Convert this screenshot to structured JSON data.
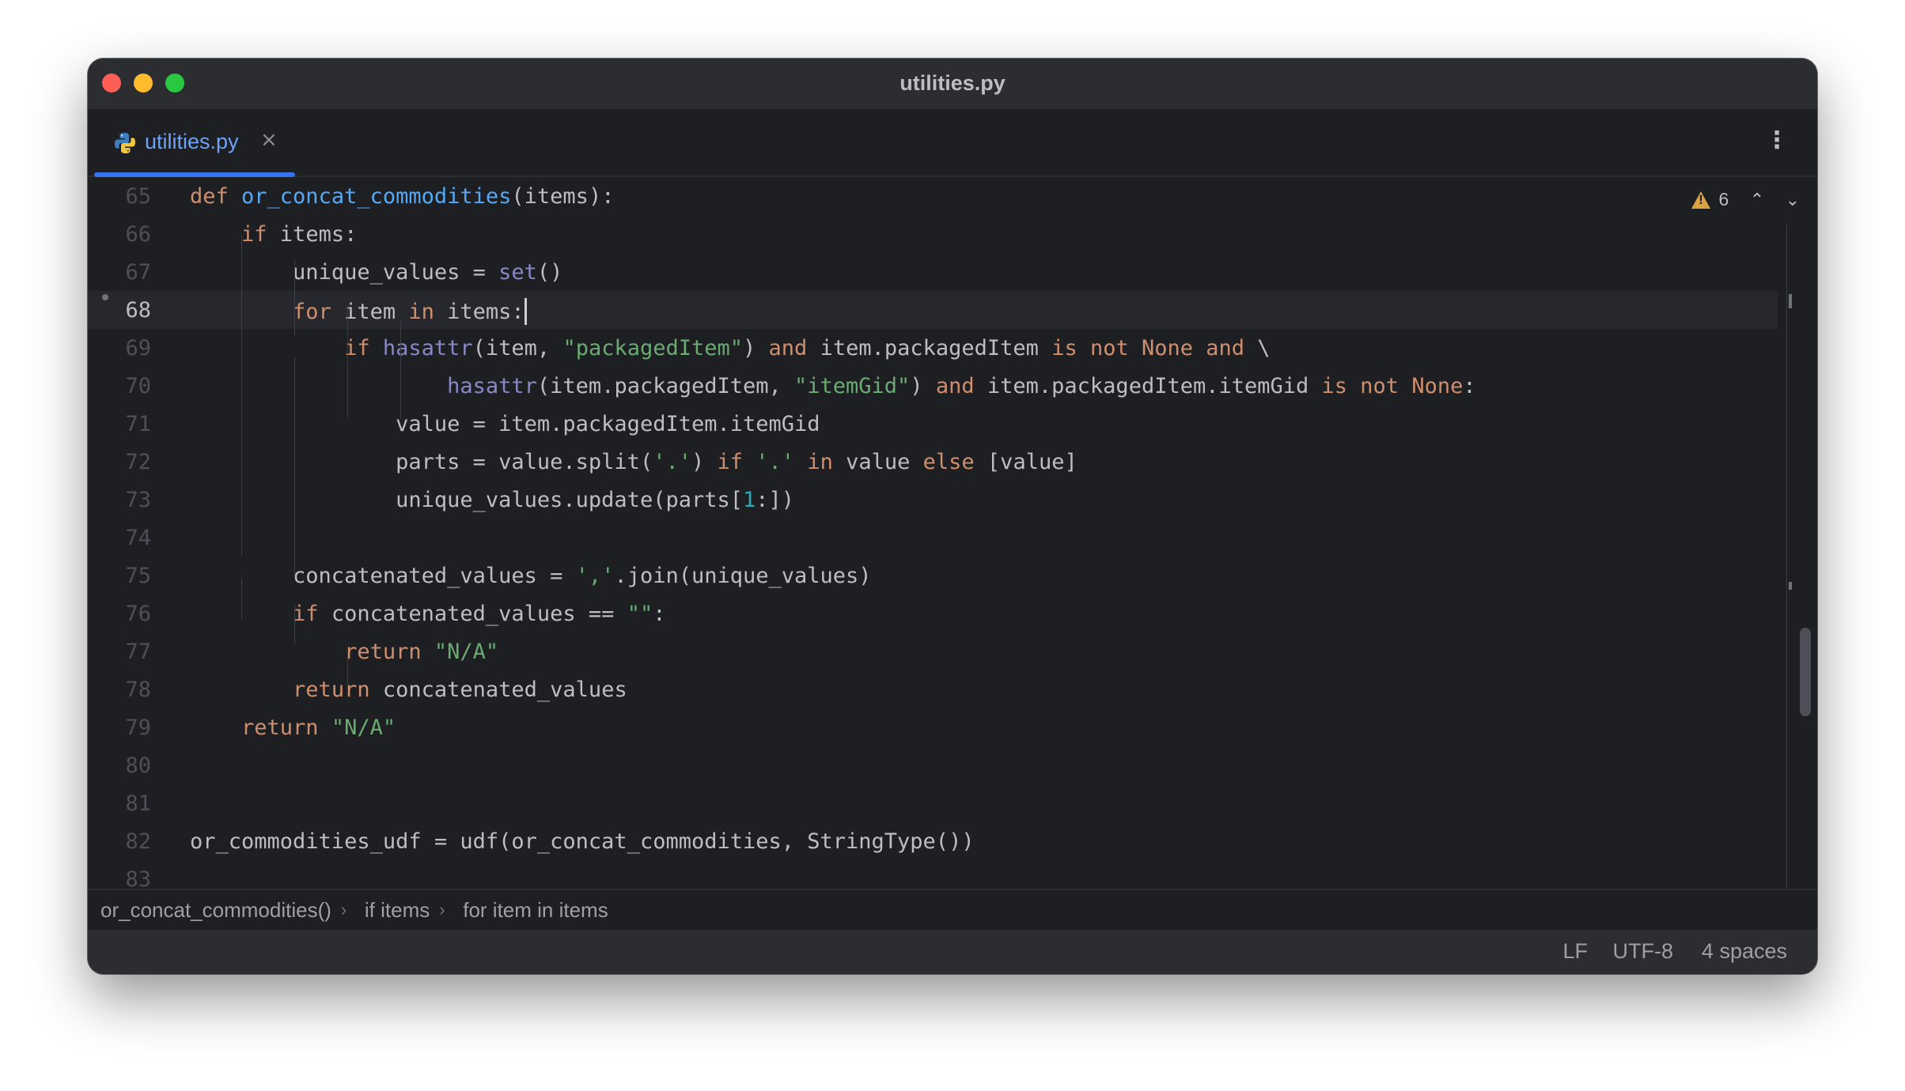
{
  "window": {
    "title": "utilities.py"
  },
  "tab": {
    "label": "utilities.py",
    "close_glyph": "×",
    "menu_glyph": "⋮"
  },
  "inspections": {
    "warning_count": "6",
    "prev_glyph": "⌃",
    "next_glyph": "⌄"
  },
  "editor": {
    "current_line": 68,
    "lines": [
      {
        "num": "65",
        "segments": [
          {
            "t": "def ",
            "c": "kw"
          },
          {
            "t": "or_concat_commodities",
            "c": "fn"
          },
          {
            "t": "(items):",
            "c": ""
          }
        ]
      },
      {
        "num": "66",
        "segments": [
          {
            "t": "    ",
            "c": ""
          },
          {
            "t": "if",
            "c": "kw"
          },
          {
            "t": " items:",
            "c": ""
          }
        ]
      },
      {
        "num": "67",
        "segments": [
          {
            "t": "        unique_values = ",
            "c": ""
          },
          {
            "t": "set",
            "c": "bi"
          },
          {
            "t": "()",
            "c": ""
          }
        ]
      },
      {
        "num": "68",
        "segments": [
          {
            "t": "        ",
            "c": ""
          },
          {
            "t": "for",
            "c": "kw"
          },
          {
            "t": " item ",
            "c": ""
          },
          {
            "t": "in",
            "c": "kw"
          },
          {
            "t": " items:",
            "c": ""
          }
        ]
      },
      {
        "num": "69",
        "segments": [
          {
            "t": "            ",
            "c": ""
          },
          {
            "t": "if ",
            "c": "kw"
          },
          {
            "t": "hasattr",
            "c": "bi"
          },
          {
            "t": "(item, ",
            "c": ""
          },
          {
            "t": "\"packagedItem\"",
            "c": "str"
          },
          {
            "t": ") ",
            "c": ""
          },
          {
            "t": "and",
            "c": "kw"
          },
          {
            "t": " item.packagedItem ",
            "c": ""
          },
          {
            "t": "is not None and",
            "c": "kw"
          },
          {
            "t": " \\",
            "c": ""
          }
        ]
      },
      {
        "num": "70",
        "segments": [
          {
            "t": "                    ",
            "c": ""
          },
          {
            "t": "hasattr",
            "c": "bi"
          },
          {
            "t": "(item.packagedItem, ",
            "c": ""
          },
          {
            "t": "\"itemGid\"",
            "c": "str"
          },
          {
            "t": ") ",
            "c": ""
          },
          {
            "t": "and",
            "c": "kw"
          },
          {
            "t": " item.packagedItem.itemGid ",
            "c": ""
          },
          {
            "t": "is not None",
            "c": "kw"
          },
          {
            "t": ":",
            "c": ""
          }
        ]
      },
      {
        "num": "71",
        "segments": [
          {
            "t": "                value = item.packagedItem.itemGid",
            "c": ""
          }
        ]
      },
      {
        "num": "72",
        "segments": [
          {
            "t": "                parts = value.split(",
            "c": ""
          },
          {
            "t": "'.'",
            "c": "str"
          },
          {
            "t": ") ",
            "c": ""
          },
          {
            "t": "if",
            "c": "kw"
          },
          {
            "t": " ",
            "c": ""
          },
          {
            "t": "'.'",
            "c": "str"
          },
          {
            "t": " ",
            "c": ""
          },
          {
            "t": "in",
            "c": "kw"
          },
          {
            "t": " value ",
            "c": ""
          },
          {
            "t": "else",
            "c": "kw"
          },
          {
            "t": " [value]",
            "c": ""
          }
        ]
      },
      {
        "num": "73",
        "segments": [
          {
            "t": "                unique_values.update(parts[",
            "c": ""
          },
          {
            "t": "1",
            "c": "num"
          },
          {
            "t": ":])",
            "c": ""
          }
        ]
      },
      {
        "num": "74",
        "segments": []
      },
      {
        "num": "75",
        "segments": [
          {
            "t": "        concatenated_values = ",
            "c": ""
          },
          {
            "t": "','",
            "c": "str"
          },
          {
            "t": ".join(unique_values)",
            "c": ""
          }
        ]
      },
      {
        "num": "76",
        "segments": [
          {
            "t": "        ",
            "c": ""
          },
          {
            "t": "if",
            "c": "kw"
          },
          {
            "t": " concatenated_values == ",
            "c": ""
          },
          {
            "t": "\"\"",
            "c": "str"
          },
          {
            "t": ":",
            "c": ""
          }
        ]
      },
      {
        "num": "77",
        "segments": [
          {
            "t": "            ",
            "c": ""
          },
          {
            "t": "return",
            "c": "kw"
          },
          {
            "t": " ",
            "c": ""
          },
          {
            "t": "\"N/A\"",
            "c": "str"
          }
        ]
      },
      {
        "num": "78",
        "segments": [
          {
            "t": "        ",
            "c": ""
          },
          {
            "t": "return",
            "c": "kw"
          },
          {
            "t": " concatenated_values",
            "c": ""
          }
        ]
      },
      {
        "num": "79",
        "segments": [
          {
            "t": "    ",
            "c": ""
          },
          {
            "t": "return",
            "c": "kw"
          },
          {
            "t": " ",
            "c": ""
          },
          {
            "t": "\"N/A\"",
            "c": "str"
          }
        ]
      },
      {
        "num": "80",
        "segments": []
      },
      {
        "num": "81",
        "segments": []
      },
      {
        "num": "82",
        "segments": [
          {
            "t": "or_commodities_udf = udf(or_concat_commodities, StringType())",
            "c": ""
          }
        ]
      },
      {
        "num": "83",
        "segments": []
      }
    ]
  },
  "breadcrumbs": [
    "or_concat_commodities()",
    "if items",
    "for item in items"
  ],
  "breadcrumb_separator": "›",
  "status": {
    "line_ending": "LF",
    "encoding": "UTF-8",
    "indent": "4 spaces"
  },
  "colors": {
    "keyword": "#cf8e6d",
    "function": "#56a8f5",
    "builtin": "#8888c6",
    "string": "#6aab73",
    "number": "#2aacb8",
    "tab_accent": "#3574f0",
    "warning": "#d9a343"
  }
}
